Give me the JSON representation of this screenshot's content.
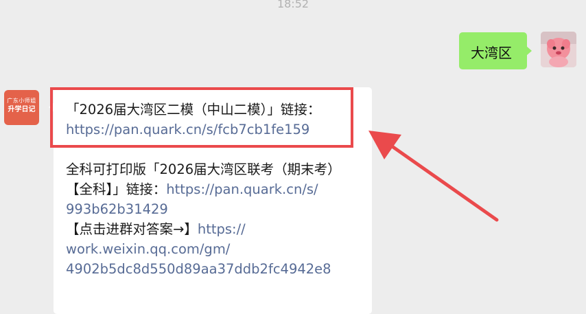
{
  "chat": {
    "timestamp": "18:52",
    "self_message": {
      "text": "大湾区",
      "bubble_color": "#95ec69"
    },
    "other_avatar": {
      "line1": "广东小师姐",
      "line2": "升学日记",
      "color": "#e4624a"
    },
    "reply": {
      "line1": "「2026届大湾区二模（中山二模）」链接：",
      "link1": "https://pan.quark.cn/s/fcb7cb1fe159",
      "line2": "全科可打印版「2026届大湾区联考（期末考）",
      "line3_text": "【全科】」链接：",
      "line3_link": "https://pan.quark.cn/s/",
      "line4_link": "993b62b31429",
      "line5_text": "【点击进群对答案→】",
      "line5_link": "https://",
      "line6_link": "work.weixin.qq.com/gm/",
      "line7_link": "4902b5dc8d550d89aa37ddb2fc4942e8"
    },
    "colors": {
      "background": "#ededed",
      "link": "#576b95",
      "annotation_red": "#ea4a4c"
    }
  }
}
